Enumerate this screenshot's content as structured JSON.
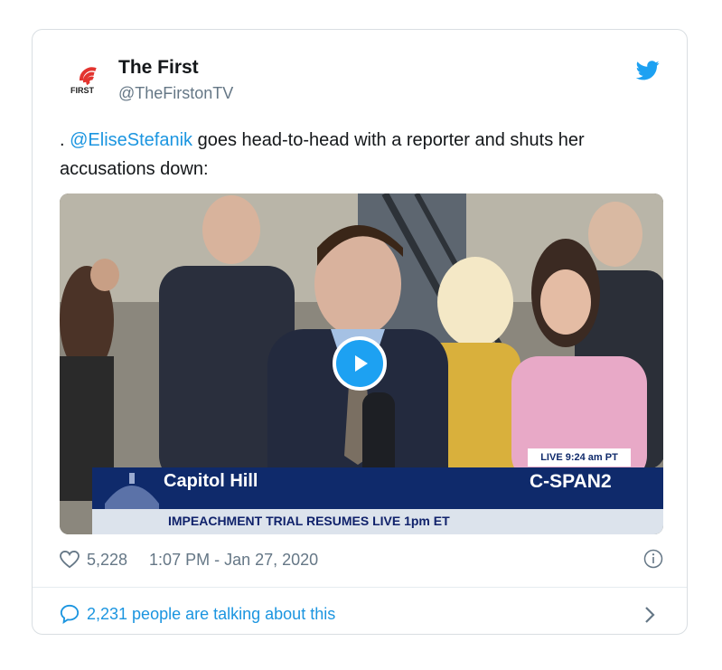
{
  "tweet": {
    "author_name": "The First",
    "author_handle": "@TheFirstonTV",
    "avatar_logo_text": "FIRST",
    "text_prefix": ". ",
    "mention": "@EliseStefanik",
    "text_body": " goes head-to-head with a reporter and shuts her accusations down:",
    "likes": "5,228",
    "timestamp": "1:07 PM - Jan 27, 2020",
    "talking": "2,231 people are talking about this"
  },
  "video": {
    "live_label": "LIVE 9:24 am PT",
    "location": "Capitol Hill",
    "network": "C-SPAN2",
    "ticker": "IMPEACHMENT TRIAL RESUMES LIVE 1pm ET"
  },
  "colors": {
    "twitter_blue": "#1da1f2",
    "link_blue": "#1b95e0",
    "secondary_text": "#657786",
    "cspan_navy": "#0f2a6b"
  },
  "icons": [
    "twitter-bird-icon",
    "play-icon",
    "heart-icon",
    "info-icon",
    "comment-icon",
    "chevron-right-icon"
  ]
}
